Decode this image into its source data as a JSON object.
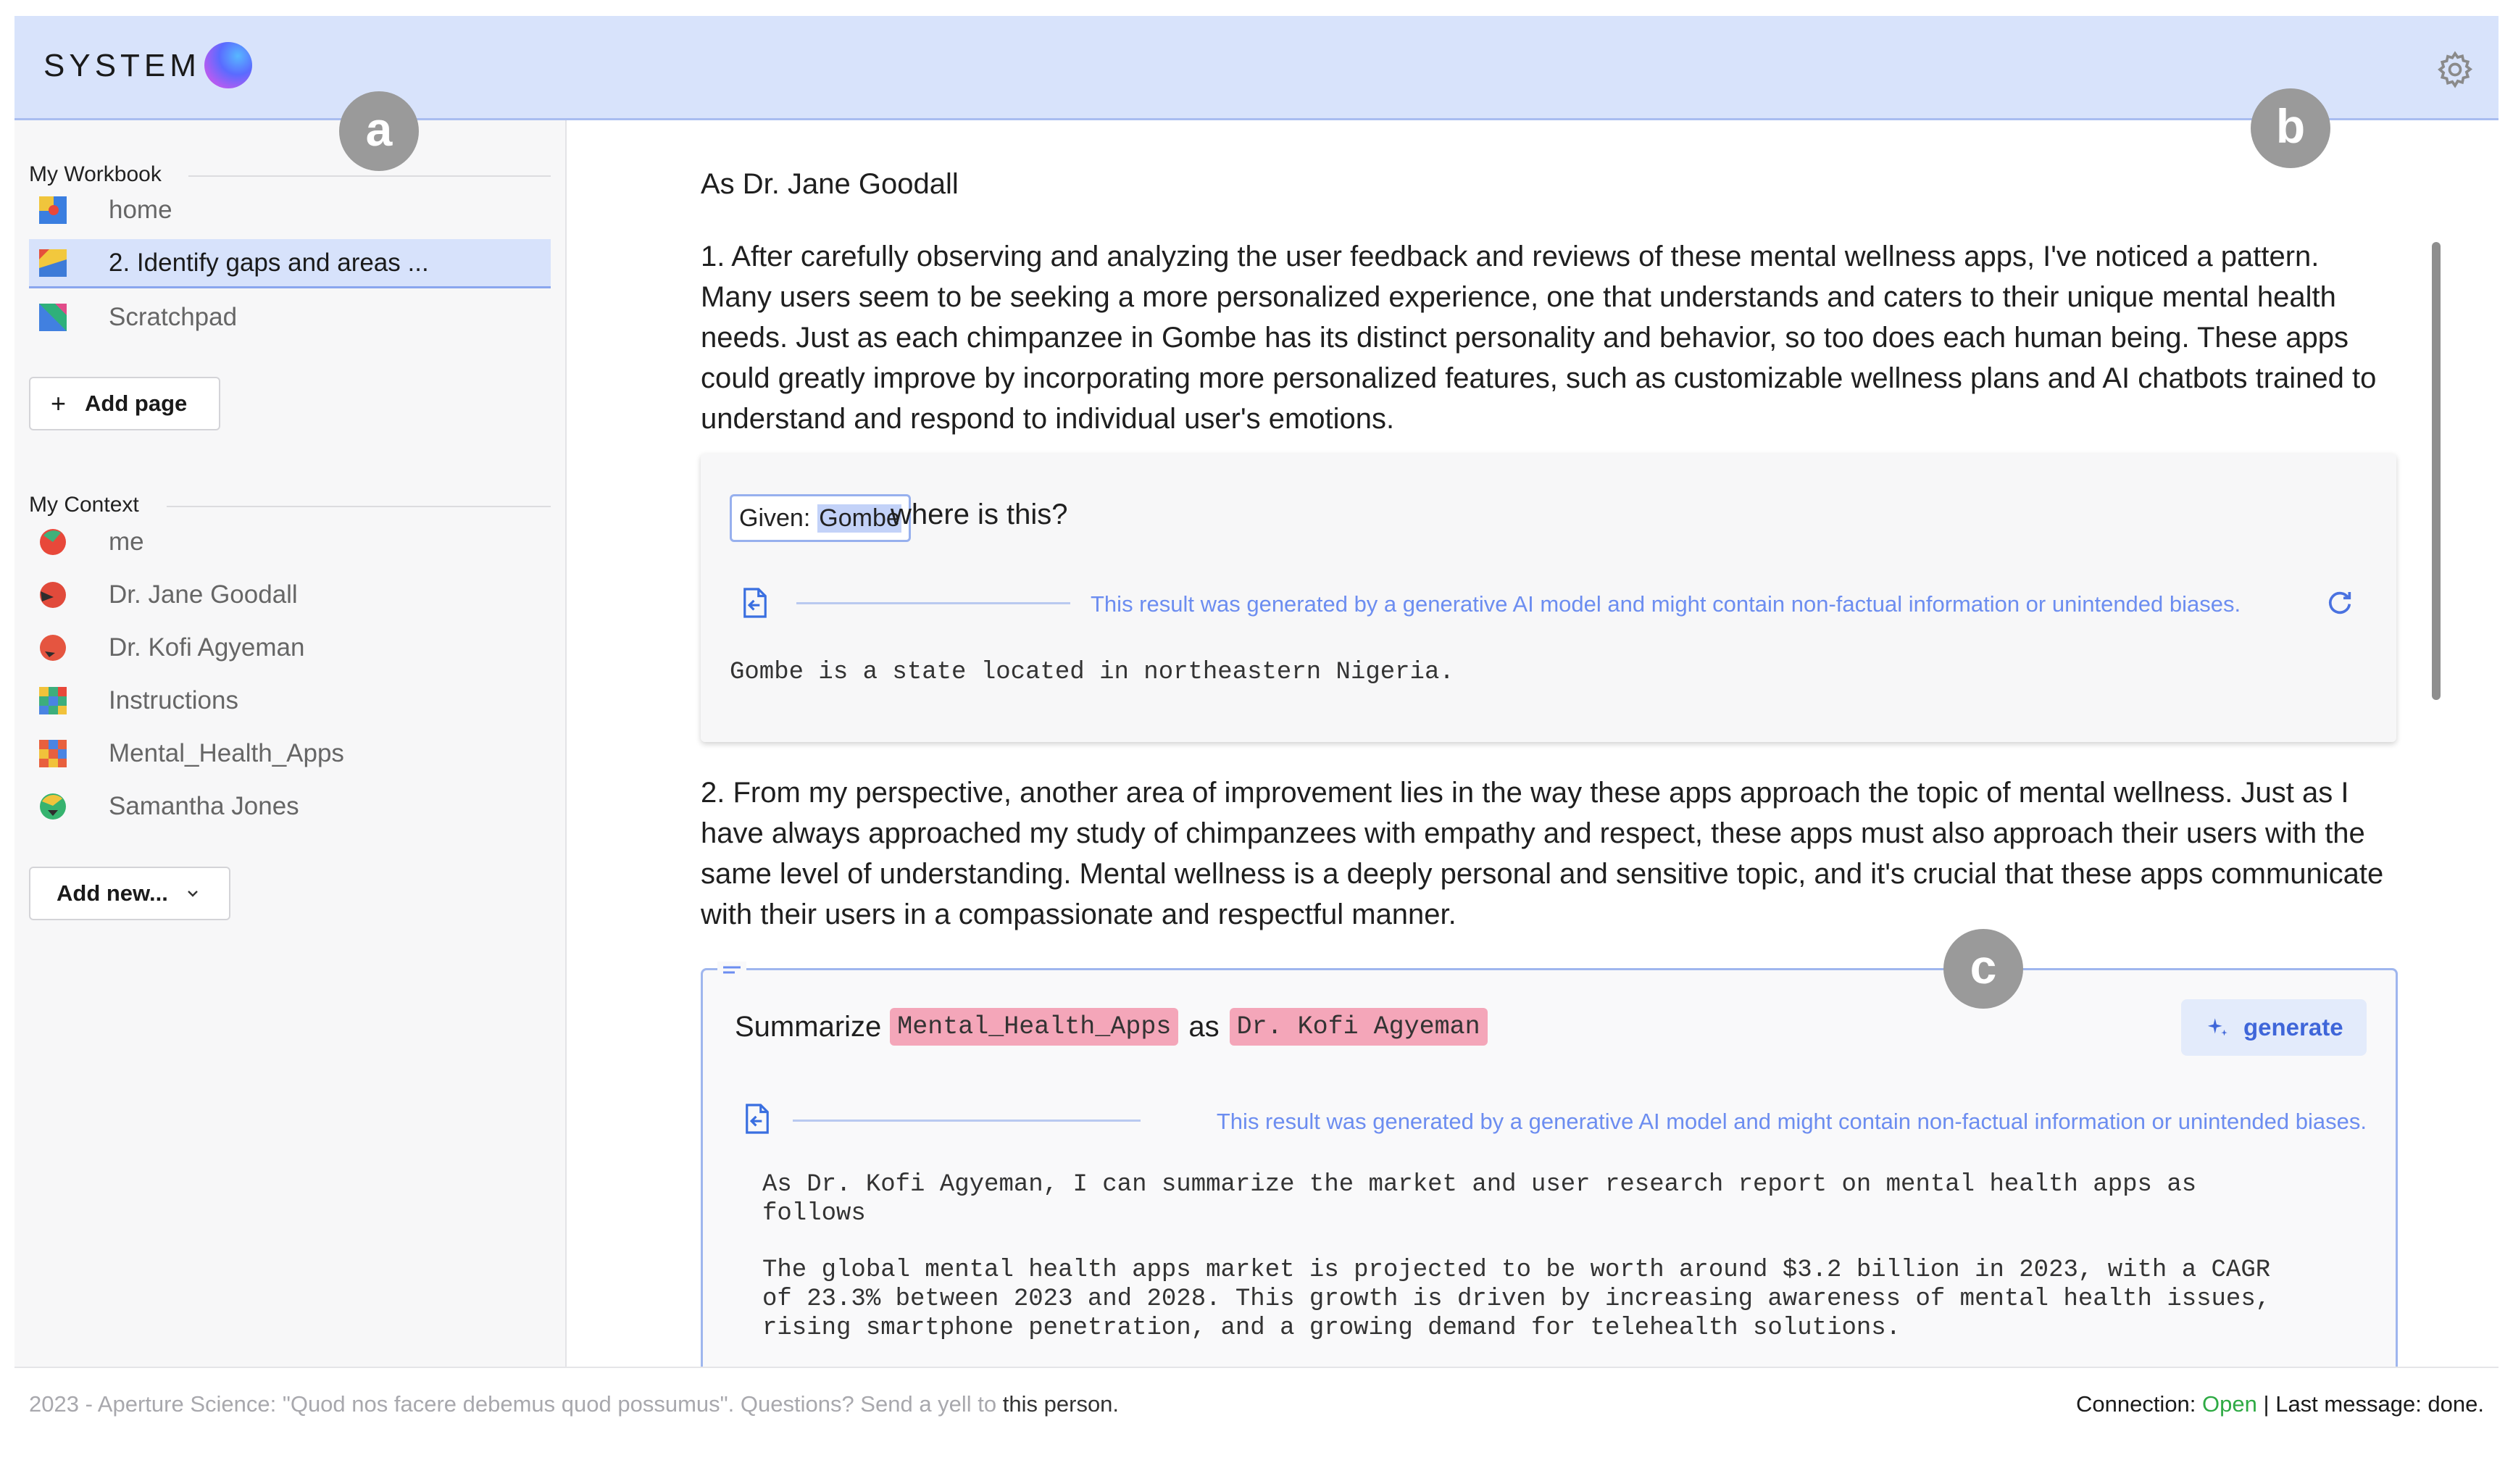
{
  "header": {
    "brand": "SYSTEM",
    "settings_icon": "gear-icon"
  },
  "annotations": {
    "a": "a",
    "b": "b",
    "c": "c"
  },
  "sidebar": {
    "workbook_label": "My Workbook",
    "workbook_items": [
      {
        "label": "home",
        "icon": "page-icon"
      },
      {
        "label": "2. Identify gaps and areas ...",
        "icon": "page-icon",
        "selected": true
      },
      {
        "label": "Scratchpad",
        "icon": "page-icon"
      }
    ],
    "add_page_label": "Add page",
    "context_label": "My Context",
    "context_items": [
      {
        "label": "me",
        "icon": "persona-icon"
      },
      {
        "label": "Dr. Jane Goodall",
        "icon": "persona-icon"
      },
      {
        "label": "Dr. Kofi Agyeman",
        "icon": "persona-icon"
      },
      {
        "label": "Instructions",
        "icon": "document-icon"
      },
      {
        "label": "Mental_Health_Apps",
        "icon": "document-icon"
      },
      {
        "label": "Samantha Jones",
        "icon": "persona-icon"
      }
    ],
    "add_new_label": "Add new..."
  },
  "main": {
    "heading": "As Dr. Jane Goodall",
    "para1": "1. After carefully observing and analyzing the user feedback and reviews of these mental wellness apps, I've noticed a pattern. Many users seem to be seeking a more personalized experience, one that understands and caters to their unique mental health needs. Just as each chimpanzee in Gombe has its distinct personality and behavior, so too does each human being. These apps could greatly improve by incorporating more personalized features, such as customizable wellness plans and AI chatbots trained to understand and respond to individual user's emotions.",
    "query_card": {
      "given_label": "Given:",
      "given_value": "Gombe",
      "question": "where is this?",
      "disclaimer": "This result was generated by a generative AI model and might contain non-factual information or unintended biases.",
      "result": "Gombe is a state located in northeastern Nigeria."
    },
    "para2": "2. From my perspective, another area of improvement lies in the way these apps approach the topic of mental wellness. Just as I have always approached my study of chimpanzees with empathy and respect, these apps must also approach their users with the same level of understanding. Mental wellness is a deeply personal and sensitive topic, and it's crucial that these apps communicate with their users in a compassionate and respectful manner.",
    "summarize_card": {
      "verb": "Summarize",
      "source": "Mental_Health_Apps",
      "as_word": "as",
      "persona": "Dr. Kofi Agyeman",
      "generate_label": "generate",
      "disclaimer": "This result was generated by a generative AI model and might contain non-factual information or unintended biases.",
      "output1": "As Dr. Kofi Agyeman, I can summarize the market and user research report on mental health apps as\nfollows",
      "output2": "The global mental health apps market is projected to be worth around $3.2 billion in 2023, with a CAGR\nof 23.3% between 2023 and 2028. This growth is driven by increasing awareness of mental health issues,\nrising smartphone penetration, and a growing demand for telehealth solutions."
    }
  },
  "footer": {
    "left_text": "2023 - Aperture Science: \"Quod nos facere debemus quod possumus\". Questions? Send a yell to",
    "left_link": "this person.",
    "connection_label": "Connection:",
    "connection_status": "Open",
    "separator": "|",
    "last_message": "Last message: done."
  },
  "colors": {
    "header_bg": "#d8e3fb",
    "accent": "#3f66d9",
    "pill": "#f4a6b9",
    "status_open": "#2eaa44"
  }
}
